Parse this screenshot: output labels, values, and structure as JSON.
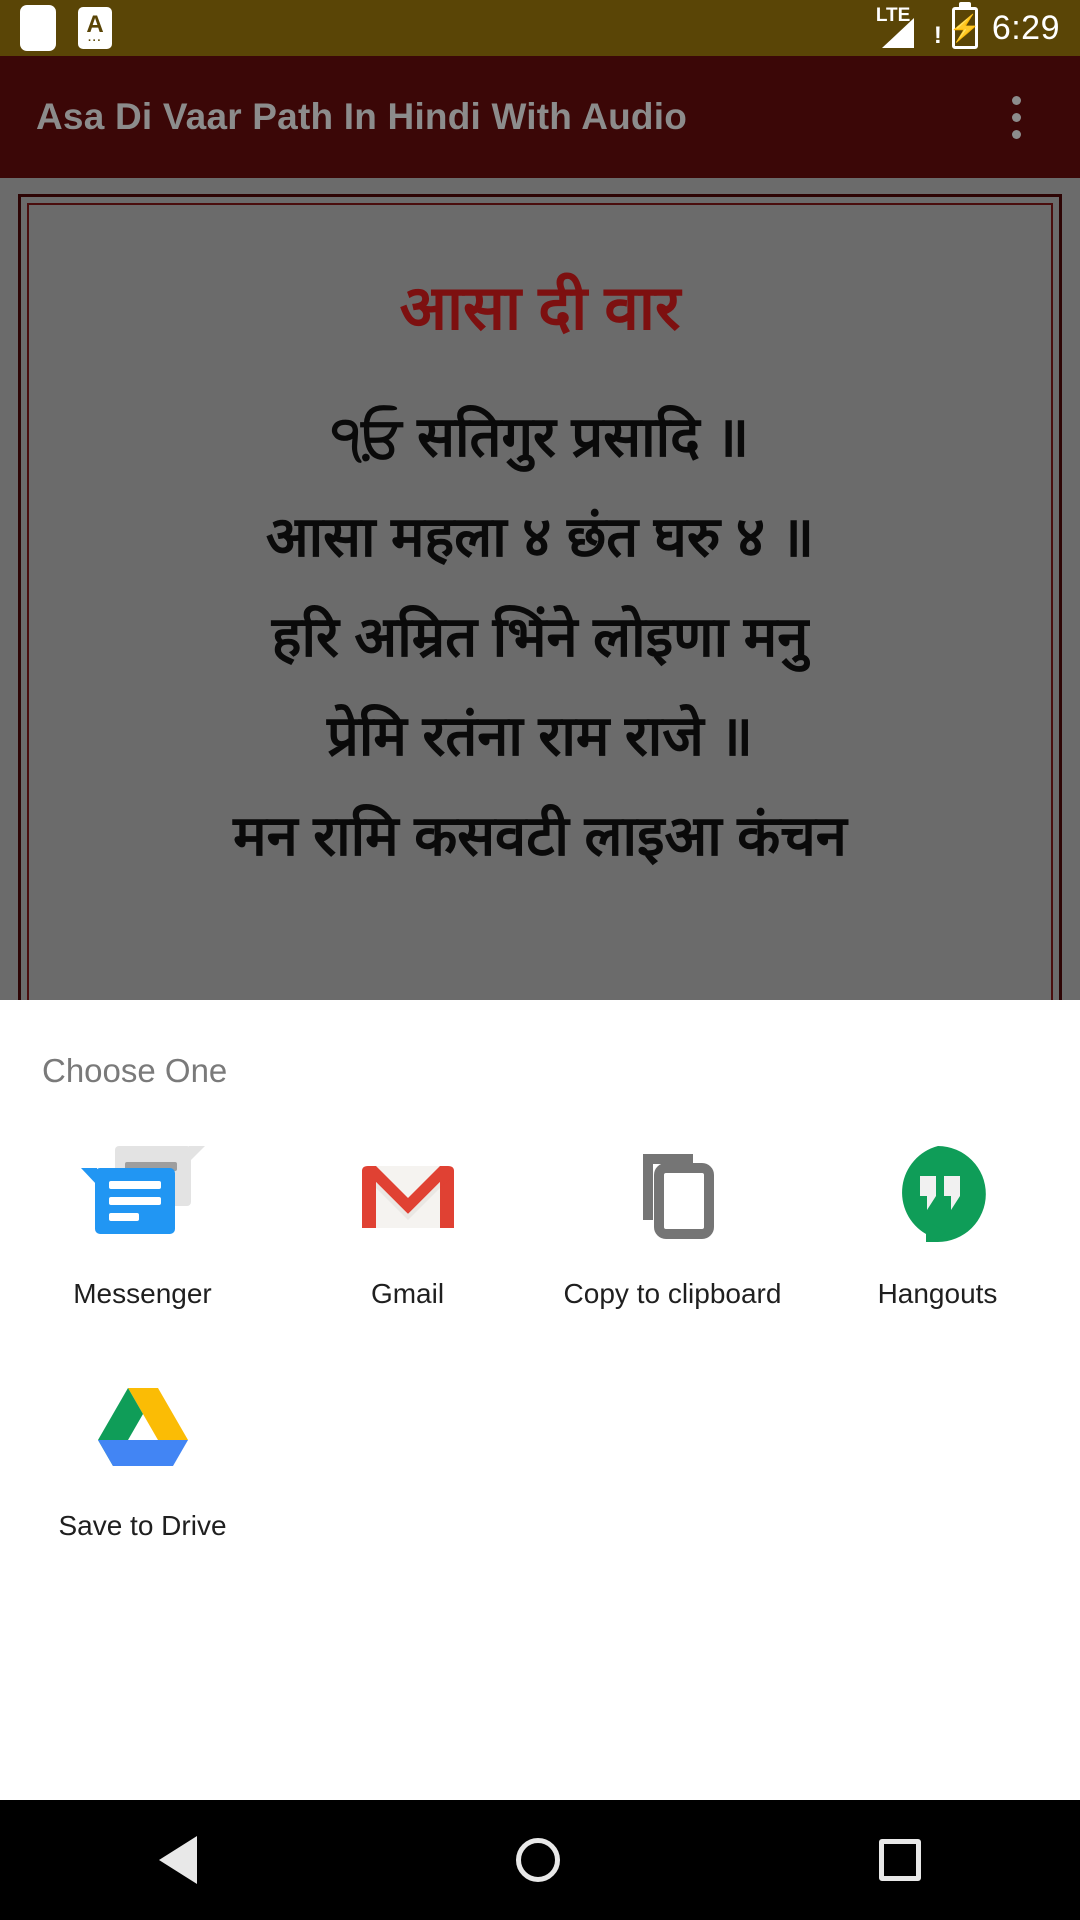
{
  "status_bar": {
    "notification_icons": [
      "blank-notification-icon",
      "a-text-notification-icon"
    ],
    "a_icon_letter": "A",
    "a_icon_dots": "···",
    "network_label": "LTE",
    "network_warning": "!",
    "clock": "6:29",
    "signal_icon": "signal-triangle-icon",
    "battery_icon": "battery-charging-icon",
    "battery_bolt": "⚡",
    "background_color": "#5a4506"
  },
  "app_bar": {
    "title": "Asa Di Vaar Path In Hindi With Audio",
    "overflow_icon": "overflow-menu-icon",
    "background_color": "#3b0707",
    "title_color": "#8c8c8c"
  },
  "content": {
    "doc_title": "आसा दी वार",
    "doc_title_color": "#7d1010",
    "lines": [
      "੧ਓ਼ सतिगुर प्रसादि ॥",
      "आसा महला ४ छंत घरु ४  ॥",
      "हरि अम्रित भिंने लोइणा मनु",
      "प्रेमि रतंना राम राजे ॥",
      "मन रामि कसवटी लाइआ कंचन"
    ],
    "background_color": "#6b6b6b",
    "frame_color": "#2d0404"
  },
  "bottom_sheet": {
    "title": "Choose One",
    "items": [
      {
        "label": "Messenger",
        "icon": "messenger-icon"
      },
      {
        "label": "Gmail",
        "icon": "gmail-icon"
      },
      {
        "label": "Copy to clipboard",
        "icon": "copy-to-clipboard-icon"
      },
      {
        "label": "Hangouts",
        "icon": "hangouts-icon"
      },
      {
        "label": "Save to Drive",
        "icon": "google-drive-icon"
      }
    ]
  },
  "navigation_bar": {
    "back": "back-nav-icon",
    "home": "home-nav-icon",
    "recents": "recents-nav-icon"
  }
}
